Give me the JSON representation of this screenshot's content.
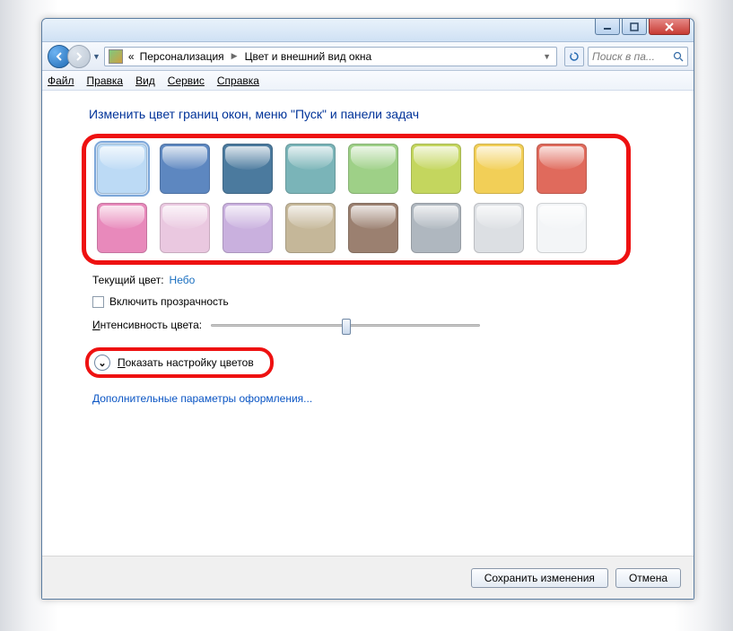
{
  "breadcrumb": {
    "prefix": "«",
    "parent": "Персонализация",
    "current": "Цвет и внешний вид окна"
  },
  "search": {
    "placeholder": "Поиск в па..."
  },
  "menu": {
    "file": "Файл",
    "edit": "Правка",
    "view": "Вид",
    "tools": "Сервис",
    "help": "Справка"
  },
  "heading": "Изменить цвет границ окон, меню \"Пуск\" и панели задач",
  "swatches_row1": [
    "#bcdaf5",
    "#5d87c0",
    "#4b7a9e",
    "#7ab4b8",
    "#9ed087",
    "#c4d65e",
    "#f2cf57",
    "#e06a5c"
  ],
  "swatches_row2": [
    "#e889bb",
    "#eac8e0",
    "#c9b0de",
    "#c5b799",
    "#9b8070",
    "#afb7bf",
    "#dcdfe3",
    "#f3f5f7"
  ],
  "selected_index": 0,
  "current_color": {
    "label": "Текущий цвет:",
    "value": "Небо"
  },
  "transparency_label": "Включить прозрачность",
  "intensity_label": "Интенсивность цвета:",
  "mixer_label": "Показать настройку цветов",
  "advanced_link": "Дополнительные параметры оформления...",
  "buttons": {
    "save": "Сохранить изменения",
    "cancel": "Отмена"
  }
}
